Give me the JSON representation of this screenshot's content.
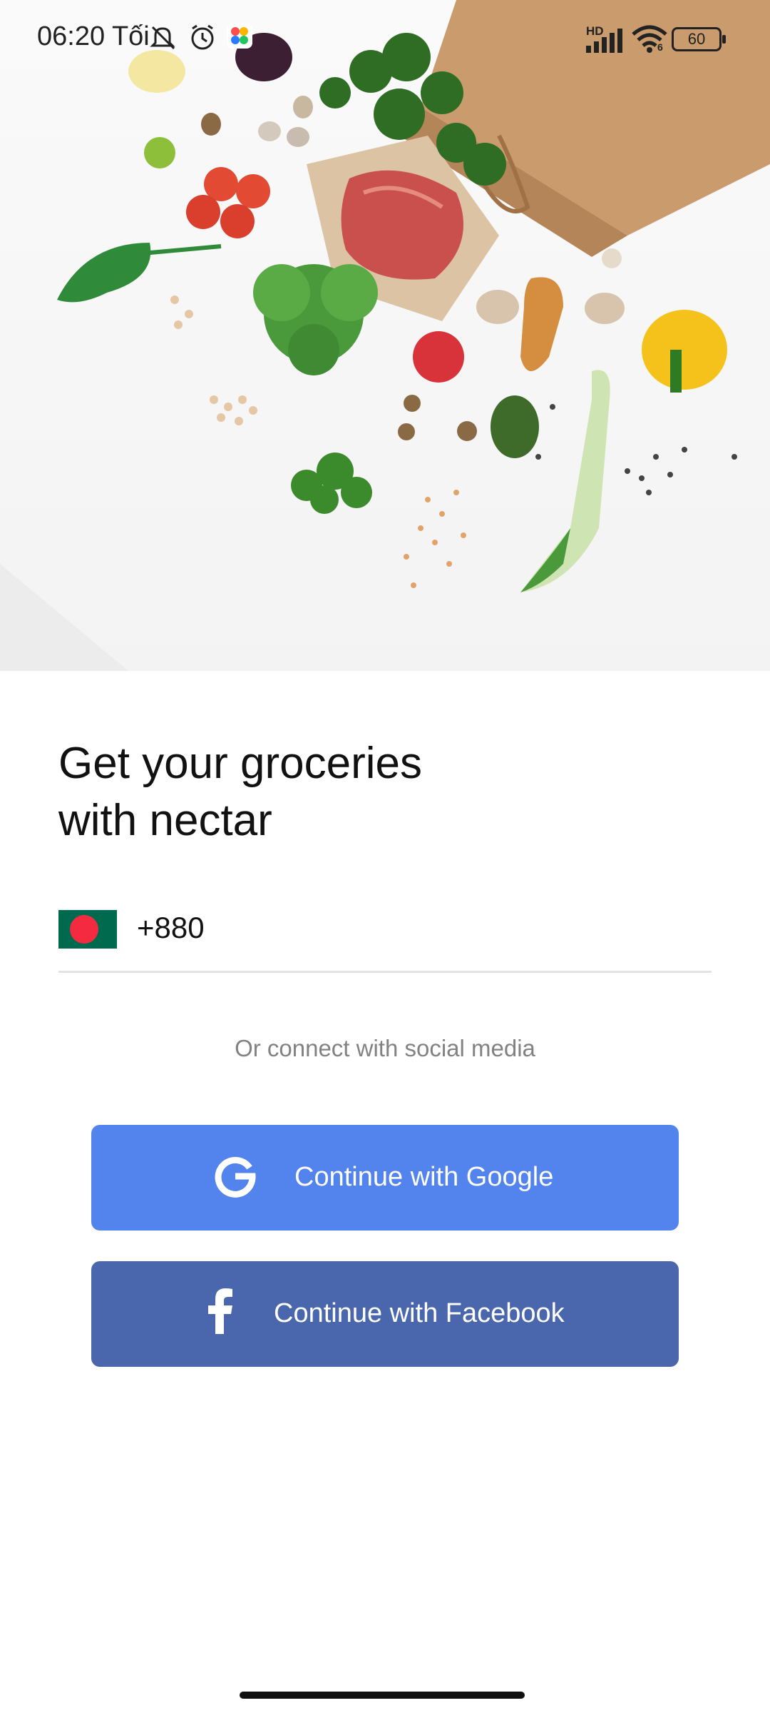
{
  "status_bar": {
    "time": "06:20 Tối",
    "network_label": "HD",
    "wifi_label": "6",
    "battery": "60",
    "icons": [
      "mute-icon",
      "alarm-icon",
      "app-notification-icon",
      "signal-icon",
      "wifi-icon",
      "battery-icon"
    ]
  },
  "hero": {
    "image": "groceries-illustration"
  },
  "headline": {
    "line1": "Get your groceries",
    "line2": "with nectar"
  },
  "phone": {
    "country_flag": "bangladesh-flag",
    "country_code": "+880",
    "value": ""
  },
  "social": {
    "label": "Or connect with social media",
    "google_label": "Continue with Google",
    "facebook_label": "Continue with Facebook",
    "google_color": "#5383ec",
    "facebook_color": "#4a66ac"
  }
}
